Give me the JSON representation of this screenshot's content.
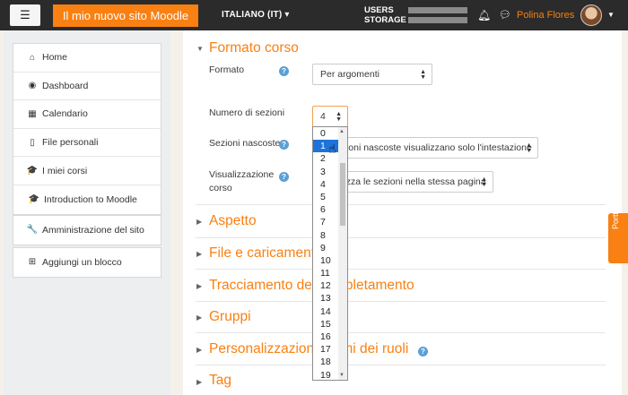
{
  "navbar": {
    "menu_icon": "hamburger-icon",
    "site_name": "Il mio nuovo sito Moodle",
    "language": "ITALIANO (IT) ▾",
    "users_label": "USERS",
    "storage_label": "STORAGE",
    "user_name": "Polina Flores"
  },
  "sidebar": {
    "items": [
      {
        "icon": "home-icon",
        "glyph": "⌂",
        "label": "Home"
      },
      {
        "icon": "dashboard-icon",
        "glyph": "◉",
        "label": "Dashboard"
      },
      {
        "icon": "calendar-icon",
        "glyph": "▦",
        "label": "Calendario"
      },
      {
        "icon": "file-icon",
        "glyph": "▯",
        "label": "File personali"
      },
      {
        "icon": "graduation-cap-icon",
        "glyph": "🎓",
        "label": "I miei corsi"
      },
      {
        "icon": "graduation-cap-icon",
        "glyph": "🎓",
        "label": "Introduction to Moodle"
      }
    ],
    "admin": {
      "icon": "wrench-icon",
      "glyph": "🔧",
      "label": "Amministrazione del sito"
    },
    "add_block": {
      "icon": "plus-square-icon",
      "glyph": "⊞",
      "label": "Aggiungi un blocco"
    }
  },
  "main": {
    "formato_corso": {
      "title": "Formato corso",
      "formato_label": "Formato",
      "formato_value": "Per argomenti",
      "numero_label": "Numero di sezioni",
      "numero_value": "4",
      "nascoste_label": "Sezioni nascoste",
      "nascoste_value": "Le sezioni nascoste visualizzano solo l'intestazione",
      "visual_label_1": "Visualizzazione",
      "visual_label_2": "corso",
      "visual_value": "Visualizza le sezioni nella stessa pagina"
    },
    "sections": [
      "Aspetto",
      "File e caricamenti",
      "Tracciamento del completamento",
      "Gruppi",
      "Personalizzazione nomi dei ruoli",
      "Tag"
    ]
  },
  "dropdown": {
    "options": [
      "0",
      "1",
      "2",
      "3",
      "4",
      "5",
      "6",
      "7",
      "8",
      "9",
      "10",
      "11",
      "12",
      "13",
      "14",
      "15",
      "16",
      "17",
      "18",
      "19"
    ],
    "highlighted": "1"
  },
  "side_tab": {
    "label": "Portfolio"
  }
}
